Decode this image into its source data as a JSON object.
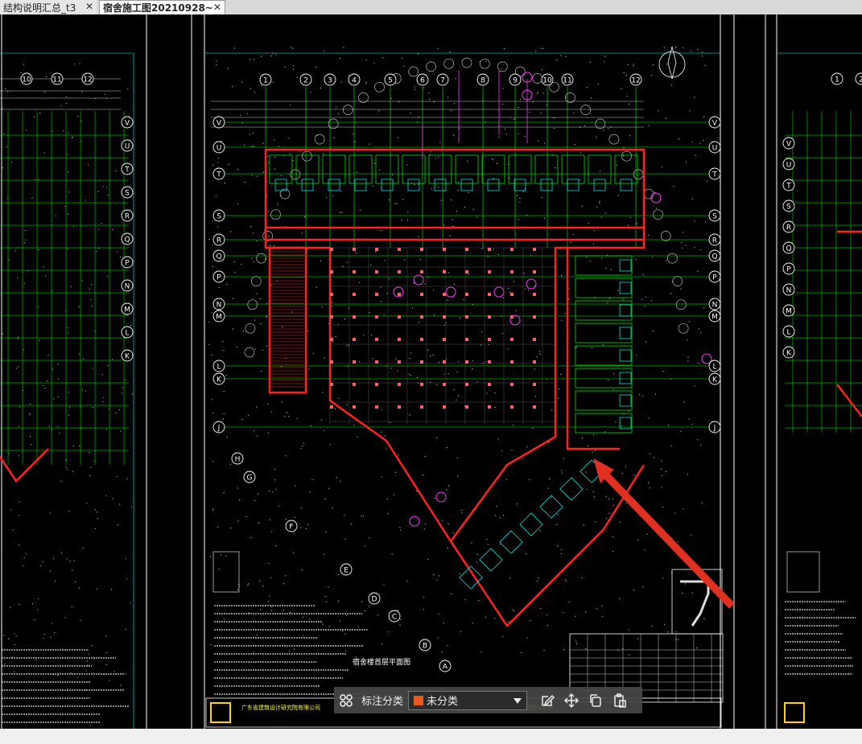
{
  "tabs": [
    {
      "label": "结构说明汇总_t3"
    },
    {
      "label": "宿舍施工图20210928~"
    }
  ],
  "drawing": {
    "axis_top": [
      "1",
      "2",
      "3",
      "4",
      "5",
      "6",
      "7",
      "8",
      "9",
      "10",
      "11",
      "12"
    ],
    "axis_left": [
      "V",
      "U",
      "T",
      "S",
      "R",
      "Q",
      "P",
      "N",
      "M",
      "L",
      "K",
      "J"
    ],
    "axis_diag": [
      "H",
      "G",
      "F",
      "E",
      "D",
      "C",
      "B",
      "A"
    ],
    "title": "宿舍楼首层平面图",
    "company": "广东省建筑设计研究院有限公司"
  },
  "toolbar": {
    "category_label": "标注分类",
    "category_value": "未分类",
    "swatch_color": "#e8591a"
  },
  "colors": {
    "background": "#000000",
    "grid_green": "#00ff00",
    "wall_red": "#ff2020",
    "magenta": "#ff33ff",
    "cyan": "#00ffff",
    "white": "#ffffff",
    "arrow": "#e03020"
  }
}
